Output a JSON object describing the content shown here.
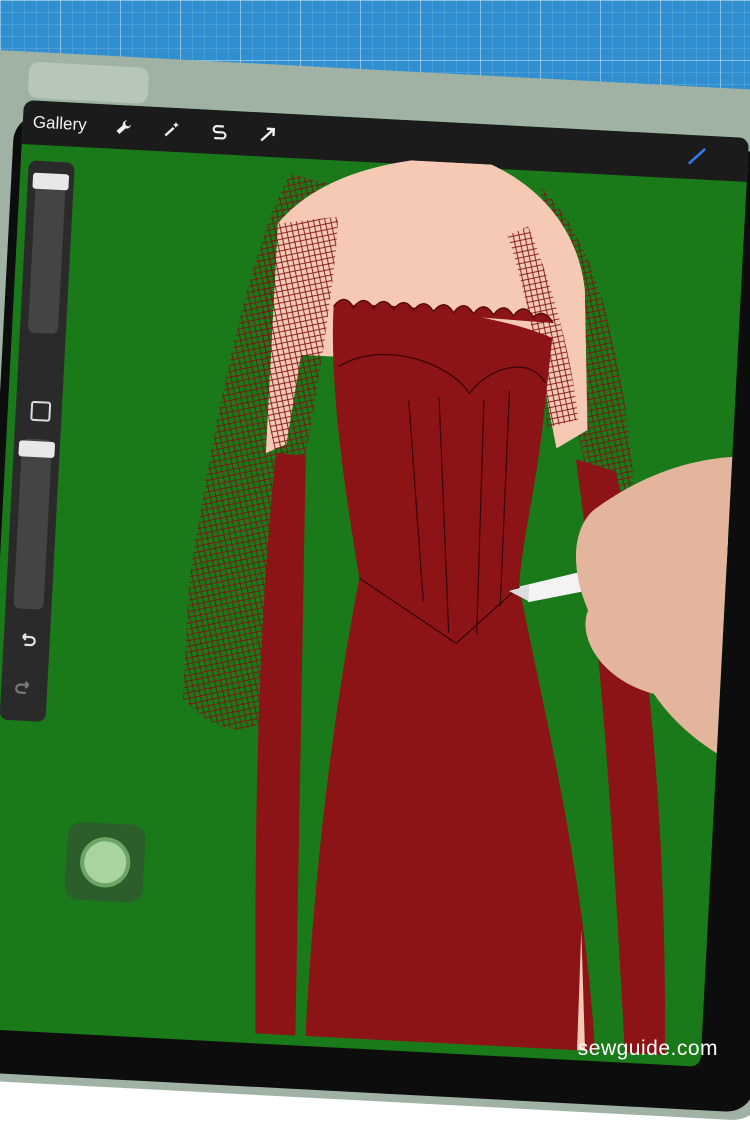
{
  "app": {
    "toolbar": {
      "gallery_label": "Gallery",
      "tools": [
        {
          "icon": "wrench-icon"
        },
        {
          "icon": "magic-wand-icon"
        },
        {
          "icon": "selection-s-icon"
        },
        {
          "icon": "move-arrow-icon"
        }
      ],
      "active_tool_icon": "brush-icon"
    },
    "sidebar": {
      "size_slider_level": 0.05,
      "opacity_slider_level": 0.0,
      "modify_icon": "modify-square-icon",
      "undo_icon": "undo-arrow-icon",
      "redo_icon": "redo-arrow-icon"
    },
    "quick_button_icon": "color-circle-icon"
  },
  "colors": {
    "canvas_background": "#1a7a1a",
    "dress": "#8c1416",
    "skin": "#f6c9b4",
    "cutting_mat": "#2f8fd1"
  },
  "watermark": "sewguide.com"
}
